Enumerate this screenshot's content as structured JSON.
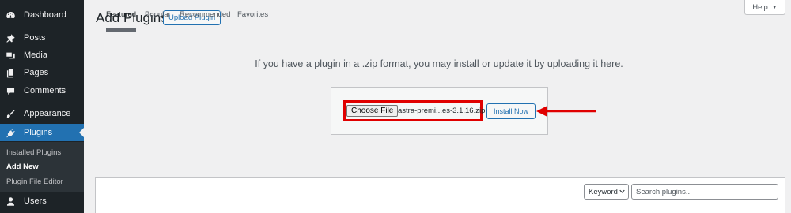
{
  "sidebar": {
    "items": [
      {
        "label": "Dashboard",
        "icon": "dashboard-icon"
      },
      {
        "label": "Posts",
        "icon": "pin-icon"
      },
      {
        "label": "Media",
        "icon": "media-icon"
      },
      {
        "label": "Pages",
        "icon": "pages-icon"
      },
      {
        "label": "Comments",
        "icon": "comment-icon"
      },
      {
        "label": "Appearance",
        "icon": "paintbrush-icon"
      },
      {
        "label": "Plugins",
        "icon": "plugin-icon",
        "active": true
      },
      {
        "label": "Users",
        "icon": "user-icon"
      }
    ],
    "submenu": [
      {
        "label": "Installed Plugins"
      },
      {
        "label": "Add New",
        "current": true
      },
      {
        "label": "Plugin File Editor"
      }
    ]
  },
  "header": {
    "title": "Add Plugins",
    "upload_label": "Upload Plugin",
    "help_label": "Help"
  },
  "upload": {
    "description": "If you have a plugin in a .zip format, you may install or update it by uploading it here.",
    "choose_file_label": "Choose File",
    "file_name": "astra-premi...es-3.1.16.zip",
    "install_label": "Install Now"
  },
  "filter": {
    "tabs": [
      "Featured",
      "Popular",
      "Recommended",
      "Favorites"
    ],
    "current_tab": "Featured",
    "search_type": "Keyword",
    "search_placeholder": "Search plugins..."
  },
  "colors": {
    "sidebar_bg": "#1d2327",
    "accent": "#2271b1",
    "highlight": "#e00000"
  }
}
